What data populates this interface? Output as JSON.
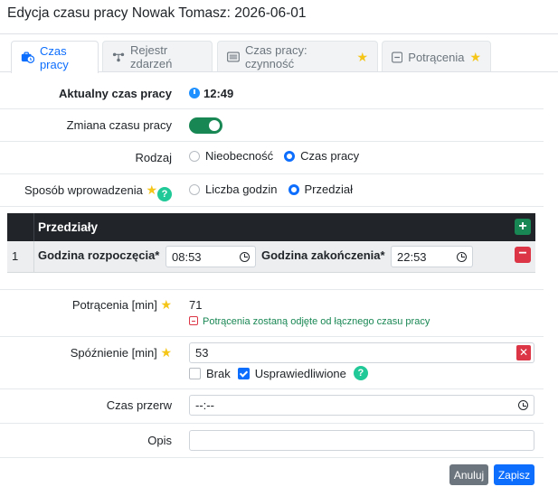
{
  "window": {
    "title": "Edycja czasu pracy Nowak Tomasz: 2026-06-01"
  },
  "tabs": [
    {
      "label": "Czas pracy",
      "icon": "briefcase-clock-icon",
      "active": true
    },
    {
      "label": "Rejestr zdarzeń",
      "icon": "network-icon",
      "active": false
    },
    {
      "label": "Czas pracy: czynność",
      "icon": "list-icon",
      "active": false,
      "starred": true
    },
    {
      "label": "Potrącenia",
      "icon": "minus-square-icon",
      "active": false,
      "starred": true
    }
  ],
  "form": {
    "current_time": {
      "label": "Aktualny czas pracy",
      "value": "12:49"
    },
    "change_time": {
      "label": "Zmiana czasu pracy",
      "enabled": true
    },
    "type": {
      "label": "Rodzaj",
      "options": [
        "Nieobecność",
        "Czas pracy"
      ],
      "selected": "Czas pracy"
    },
    "input_method": {
      "label": "Sposób wprowadzenia",
      "options": [
        "Liczba godzin",
        "Przedział"
      ],
      "selected": "Przedział"
    }
  },
  "intervals": {
    "title": "Przedziały",
    "add_symbol": "+",
    "remove_symbol": "−",
    "rows": [
      {
        "index": "1",
        "start_label": "Godzina rozpoczęcia*",
        "start": "08:53",
        "end_label": "Godzina zakończenia*",
        "end": "22:53"
      }
    ]
  },
  "deductions": {
    "label": "Potrącenia [min]",
    "value": "71",
    "note": "Potrącenia zostaną odjęte od łącznego czasu pracy"
  },
  "lateness": {
    "label": "Spóźnienie [min]",
    "value": "53",
    "clear_symbol": "✕",
    "checkboxes": [
      {
        "label": "Brak",
        "checked": false
      },
      {
        "label": "Usprawiedliwione",
        "checked": true
      }
    ]
  },
  "break_time": {
    "label": "Czas przerw",
    "value": "--:--"
  },
  "description": {
    "label": "Opis",
    "value": ""
  },
  "buttons": {
    "cancel": "Anuluj",
    "save": "Zapisz"
  },
  "colors": {
    "primary": "#0d6efd",
    "success": "#198754",
    "danger": "#dc3545",
    "secondary": "#6c757d",
    "star": "#f5c518",
    "help": "#20c997"
  }
}
